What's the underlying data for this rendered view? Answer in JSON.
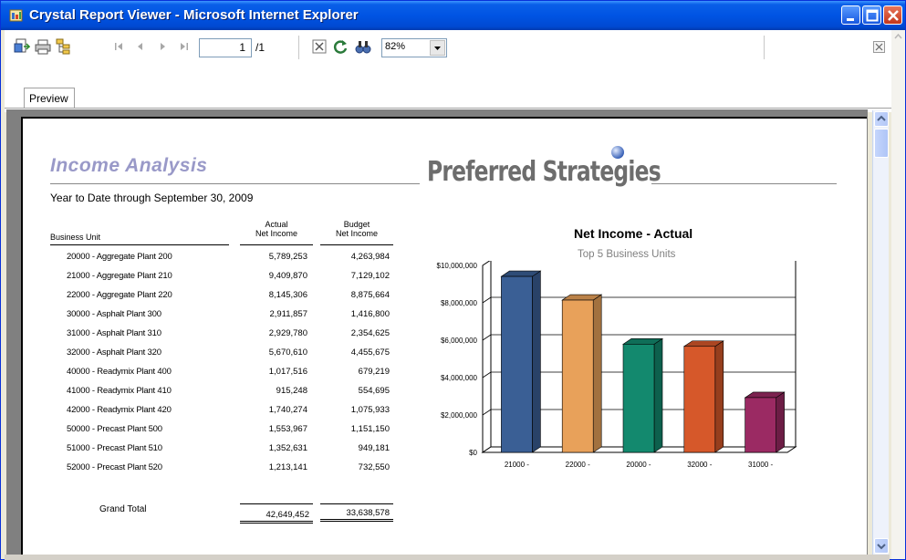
{
  "window": {
    "title": "Crystal Report Viewer - Microsoft Internet Explorer",
    "controls": [
      "minimize-icon",
      "maximize-icon",
      "close-icon"
    ]
  },
  "toolbar": {
    "icons": [
      "export-icon",
      "print-icon",
      "group-tree-icon",
      "first-page-icon",
      "previous-page-icon",
      "next-page-icon",
      "last-page-icon",
      "close-view-icon",
      "refresh-icon",
      "search-icon"
    ],
    "current_page": "1",
    "page_total": "/1",
    "zoom": "82%"
  },
  "tabs": [
    {
      "label": "Preview"
    }
  ],
  "report": {
    "title": "Income Analysis",
    "brand": "Preferred Strategies",
    "subtitle": "Year to Date through September 30, 2009",
    "columns": {
      "unit": "Business Unit",
      "actual_line1": "Actual",
      "actual_line2": "Net Income",
      "budget_line1": "Budget",
      "budget_line2": "Net Income"
    },
    "rows": [
      {
        "unit": "20000 - Aggregate Plant 200",
        "actual": "5,789,253",
        "budget": "4,263,984"
      },
      {
        "unit": "21000 - Aggregate Plant 210",
        "actual": "9,409,870",
        "budget": "7,129,102"
      },
      {
        "unit": "22000 - Aggregate Plant 220",
        "actual": "8,145,306",
        "budget": "8,875,664"
      },
      {
        "unit": "30000 - Asphalt Plant 300",
        "actual": "2,911,857",
        "budget": "1,416,800"
      },
      {
        "unit": "31000 - Asphalt Plant 310",
        "actual": "2,929,780",
        "budget": "2,354,625"
      },
      {
        "unit": "32000 - Asphalt Plant 320",
        "actual": "5,670,610",
        "budget": "4,455,675"
      },
      {
        "unit": "40000 - Readymix Plant 400",
        "actual": "1,017,516",
        "budget": "679,219"
      },
      {
        "unit": "41000 - Readymix Plant 410",
        "actual": "915,248",
        "budget": "554,695"
      },
      {
        "unit": "42000 - Readymix Plant 420",
        "actual": "1,740,274",
        "budget": "1,075,933"
      },
      {
        "unit": "50000 - Precast Plant 500",
        "actual": "1,553,967",
        "budget": "1,151,150"
      },
      {
        "unit": "51000 - Precast Plant 510",
        "actual": "1,352,631",
        "budget": "949,181"
      },
      {
        "unit": "52000 - Precast Plant 520",
        "actual": "1,213,141",
        "budget": "732,550"
      }
    ],
    "grand_total": {
      "label": "Grand Total",
      "actual": "42,649,452",
      "budget": "33,638,578"
    }
  },
  "chart_data": {
    "type": "bar",
    "title": "Net Income - Actual",
    "subtitle": "Top 5 Business Units",
    "categories": [
      "21000 -",
      "22000 -",
      "20000 -",
      "32000 -",
      "31000 -"
    ],
    "values": [
      9409870,
      8145306,
      5789253,
      5670610,
      2929780
    ],
    "colors": [
      "#3a5f95",
      "#e8a15a",
      "#13896e",
      "#d6582a",
      "#9b2a63"
    ],
    "yticks": [
      "$0",
      "$2,000,000",
      "$4,000,000",
      "$6,000,000",
      "$8,000,000",
      "$10,000,000"
    ],
    "ylim": [
      0,
      10000000
    ],
    "grid": true,
    "legend": "none"
  }
}
